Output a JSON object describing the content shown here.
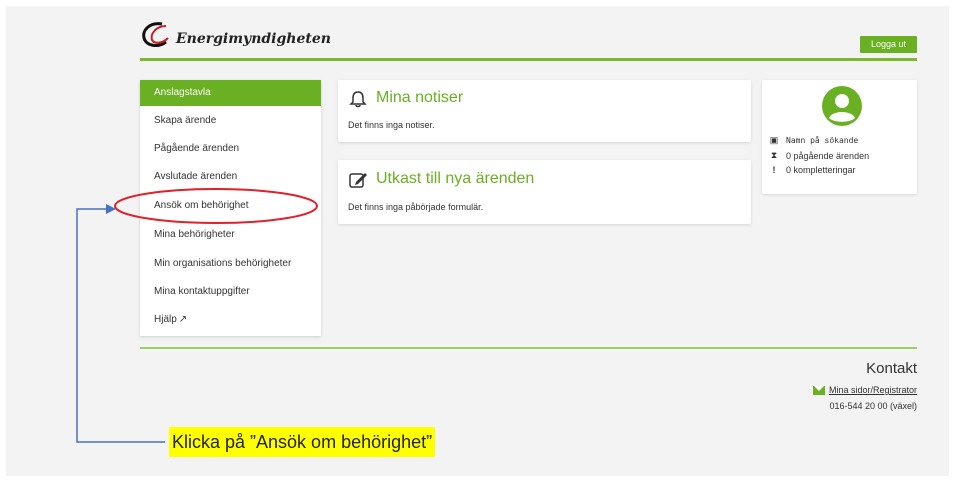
{
  "header": {
    "logo_text": "Energimyndigheten",
    "logout_label": "Logga ut"
  },
  "sidebar": {
    "items": [
      {
        "label": "Anslagstavla",
        "active": true
      },
      {
        "label": "Skapa ärende"
      },
      {
        "label": "Pågående ärenden"
      },
      {
        "label": "Avslutade ärenden"
      },
      {
        "label": "Ansök om behörighet"
      },
      {
        "label": "Mina behörigheter"
      },
      {
        "label": "Min organisations behörigheter"
      },
      {
        "label": "Mina kontaktuppgifter"
      },
      {
        "label": "Hjälp",
        "icon": "external-link-icon"
      }
    ]
  },
  "notices": {
    "title": "Mina notiser",
    "text": "Det finns inga notiser.",
    "icon": "bell-icon"
  },
  "drafts": {
    "title": "Utkast till nya ärenden",
    "text": "Det finns inga påbörjade formulär.",
    "icon": "edit-icon"
  },
  "profile": {
    "name": "Namn på sökande",
    "ongoing": "0 pågående ärenden",
    "completions": "0 kompletteringar"
  },
  "footer": {
    "contact_title": "Kontakt",
    "contact_link": "Mina sidor/Registrator",
    "phone": "016-544 20 00 (växel)"
  },
  "annotation": {
    "instruction": "Klicka på ”Ansök om behörighet”",
    "highlight_color": "#ffff00",
    "circle_color": "#e0202a",
    "arrow_color": "#4472c4"
  },
  "colors": {
    "accent": "#6ab023"
  }
}
